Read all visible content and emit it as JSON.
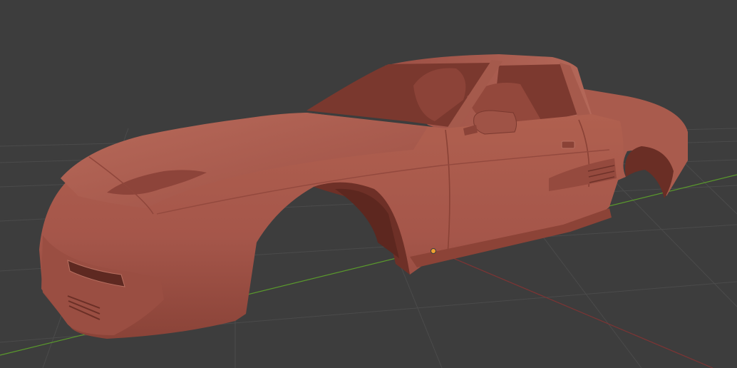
{
  "viewport": {
    "background": "#3d3d3d",
    "grid_color": "#4a4a4a",
    "x_axis_color": "#8e3a3a",
    "y_axis_color": "#5c9a2e",
    "origin_color": "#f0a030"
  },
  "model": {
    "base_color": "#a8574a",
    "shadow_color": "#6e2f26",
    "highlight_color": "#c07466",
    "interior_color": "#7f3b31"
  }
}
